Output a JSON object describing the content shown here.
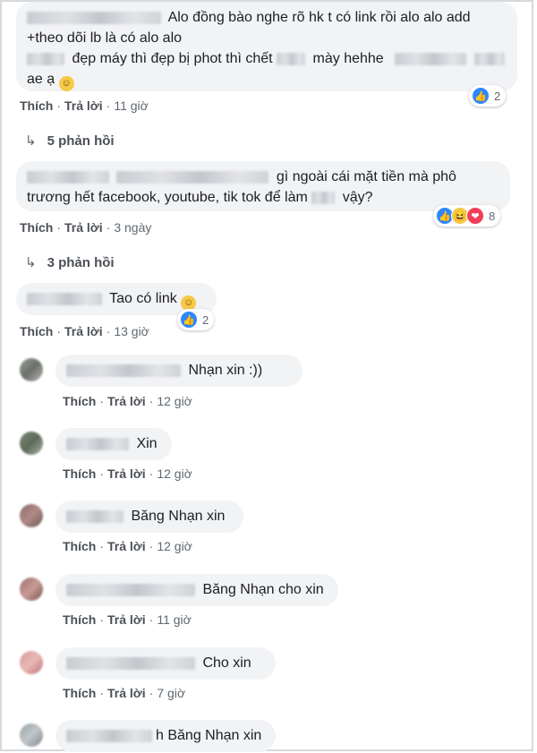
{
  "comments": [
    {
      "text_line1": "Alo đồng bào nghe rõ hk t có link rồi alo alo add",
      "text_line2": "+theo dõi lb là có alo alo",
      "text_line3a": "đẹp máy thì đẹp bị phot thì chết",
      "text_line3b": "mày hehhe",
      "text_line4": "ae ạ",
      "like_label": "Thích",
      "reply_label": "Trả lời",
      "time": "11 giờ",
      "reaction_count": "2",
      "replies_label": "5 phản hồi"
    },
    {
      "text_line1": "gì ngoài cái mặt tiền mà phô",
      "text_line2a": "trương hết facebook, youtube, tik tok để làm",
      "text_line2b": "vậy?",
      "like_label": "Thích",
      "reply_label": "Trả lời",
      "time": "3 ngày",
      "reaction_count": "8",
      "replies_label": "3 phản hồi"
    },
    {
      "text": "Tao có link",
      "like_label": "Thích",
      "reply_label": "Trả lời",
      "time": "13 giờ",
      "reaction_count": "2"
    }
  ],
  "replies": [
    {
      "text": "Nhạn xin :))",
      "like_label": "Thích",
      "reply_label": "Trả lời",
      "time": "12 giờ"
    },
    {
      "text": "Xin",
      "like_label": "Thích",
      "reply_label": "Trả lời",
      "time": "12 giờ"
    },
    {
      "text": "Băng Nhạn xin",
      "like_label": "Thích",
      "reply_label": "Trả lời",
      "time": "12 giờ"
    },
    {
      "text": "Băng Nhạn cho xin",
      "like_label": "Thích",
      "reply_label": "Trả lời",
      "time": "11 giờ"
    },
    {
      "text": "Cho xin",
      "like_label": "Thích",
      "reply_label": "Trả lời",
      "time": "7 giờ"
    },
    {
      "text_prefix": "h",
      "text": "Băng Nhạn xin"
    }
  ],
  "separator": "·",
  "icons": {
    "like": "like-icon",
    "haha": "haha-icon",
    "love": "love-icon",
    "reply_arrow": "reply-arrow-icon",
    "smile": "smile-emoji-icon"
  },
  "colors": {
    "bubble": "#f2f3f5",
    "like_blue": "#2d88ff",
    "meta_text": "#606770"
  }
}
